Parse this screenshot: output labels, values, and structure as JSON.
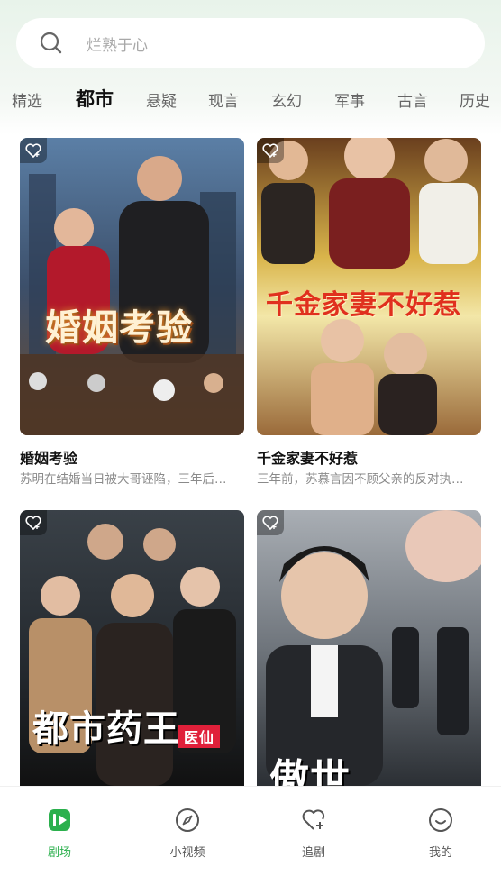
{
  "search": {
    "placeholder": "烂熟于心"
  },
  "tabs": [
    "精选",
    "都市",
    "悬疑",
    "现言",
    "玄幻",
    "军事",
    "古言",
    "历史"
  ],
  "active_tab": "都市",
  "cards": [
    {
      "title": "婚姻考验",
      "desc": "苏明在结婚当日被大哥诬陷，三年后…",
      "poster_text": "婚姻考验"
    },
    {
      "title": "千金家妻不好惹",
      "desc": "三年前，苏慕言因不顾父亲的反对执…",
      "poster_text": "千金家妻不好惹"
    },
    {
      "title": "",
      "desc": "",
      "poster_text": "都市药王",
      "poster_tag": "医仙"
    },
    {
      "title": "",
      "desc": "",
      "poster_text": "傲世"
    }
  ],
  "bottom_nav": [
    {
      "label": "剧场",
      "icon": "play-icon",
      "active": true
    },
    {
      "label": "小视频",
      "icon": "compass-icon",
      "active": false
    },
    {
      "label": "追剧",
      "icon": "heart-plus-icon",
      "active": false
    },
    {
      "label": "我的",
      "icon": "smile-icon",
      "active": false
    }
  ],
  "colors": {
    "accent": "#2bb04d",
    "background_top": "#e8f3ea"
  }
}
